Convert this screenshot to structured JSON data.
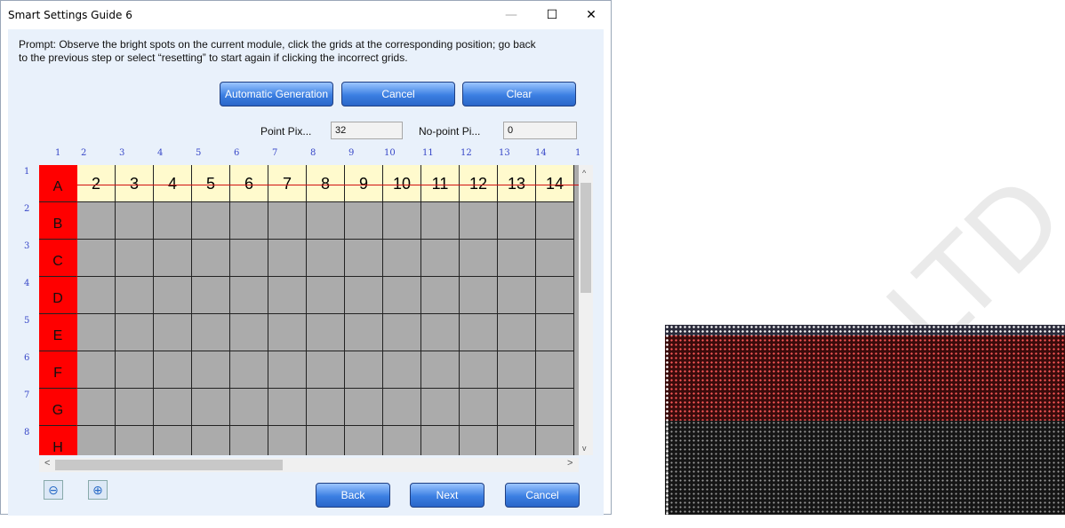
{
  "window": {
    "title": "Smart Settings Guide 6",
    "minimize_glyph": "—",
    "maximize_glyph": "☐",
    "close_glyph": "✕"
  },
  "prompt": {
    "line1": "Prompt: Observe the bright spots on the current module, click the grids at the corresponding position; go back",
    "line2": "to the previous step or select “resetting” to start again if clicking the incorrect grids."
  },
  "toolbar": {
    "auto_label": "Automatic Generation",
    "cancel_label": "Cancel",
    "clear_label": "Clear"
  },
  "fields": {
    "point_label": "Point Pix...",
    "point_value": "32",
    "nopoint_label": "No-point Pi...",
    "nopoint_value": "0"
  },
  "grid": {
    "col_numbers": [
      "1",
      "2",
      "3",
      "4",
      "5",
      "6",
      "7",
      "8",
      "9",
      "10",
      "11",
      "12",
      "13",
      "14",
      "1"
    ],
    "row_numbers": [
      "1",
      "2",
      "3",
      "4",
      "5",
      "6",
      "7",
      "8"
    ],
    "row_letters": [
      "A",
      "B",
      "C",
      "D",
      "E",
      "F",
      "G",
      "H"
    ],
    "header_cells": [
      "2",
      "3",
      "4",
      "5",
      "6",
      "7",
      "8",
      "9",
      "10",
      "11",
      "12",
      "13",
      "14"
    ]
  },
  "scroll": {
    "up": "^",
    "down": "v",
    "left": "<",
    "right": ">"
  },
  "zoom": {
    "out_glyph": "⊖",
    "in_glyph": "⊕"
  },
  "footer": {
    "back_label": "Back",
    "next_label": "Next",
    "cancel_label": "Cancel"
  },
  "colors": {
    "button_blue": "#3b7fe2",
    "row_label_red": "#ff0000",
    "header_yellow": "#fffacd",
    "cell_gray": "#ababab"
  }
}
